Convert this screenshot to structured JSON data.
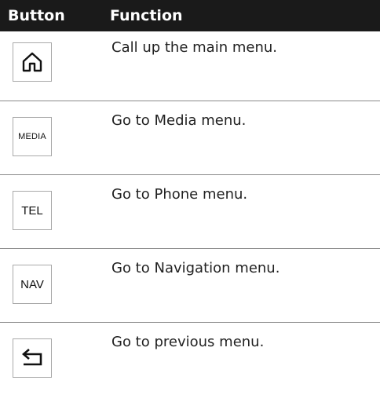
{
  "header": {
    "button_col": "Button",
    "function_col": "Function"
  },
  "rows": [
    {
      "key_icon": "home-icon",
      "key_label": "",
      "description": "Call up the main menu."
    },
    {
      "key_icon": "",
      "key_label": "MEDIA",
      "description": "Go to Media menu."
    },
    {
      "key_icon": "",
      "key_label": "TEL",
      "description": "Go to Phone menu."
    },
    {
      "key_icon": "",
      "key_label": "NAV",
      "description": "Go to Navigation menu."
    },
    {
      "key_icon": "back-arrow-icon",
      "key_label": "",
      "description": "Go to previous menu."
    }
  ],
  "colors": {
    "header_bg": "#1a1a1a",
    "header_text": "#ffffff",
    "divider": "#8a8a8a"
  }
}
